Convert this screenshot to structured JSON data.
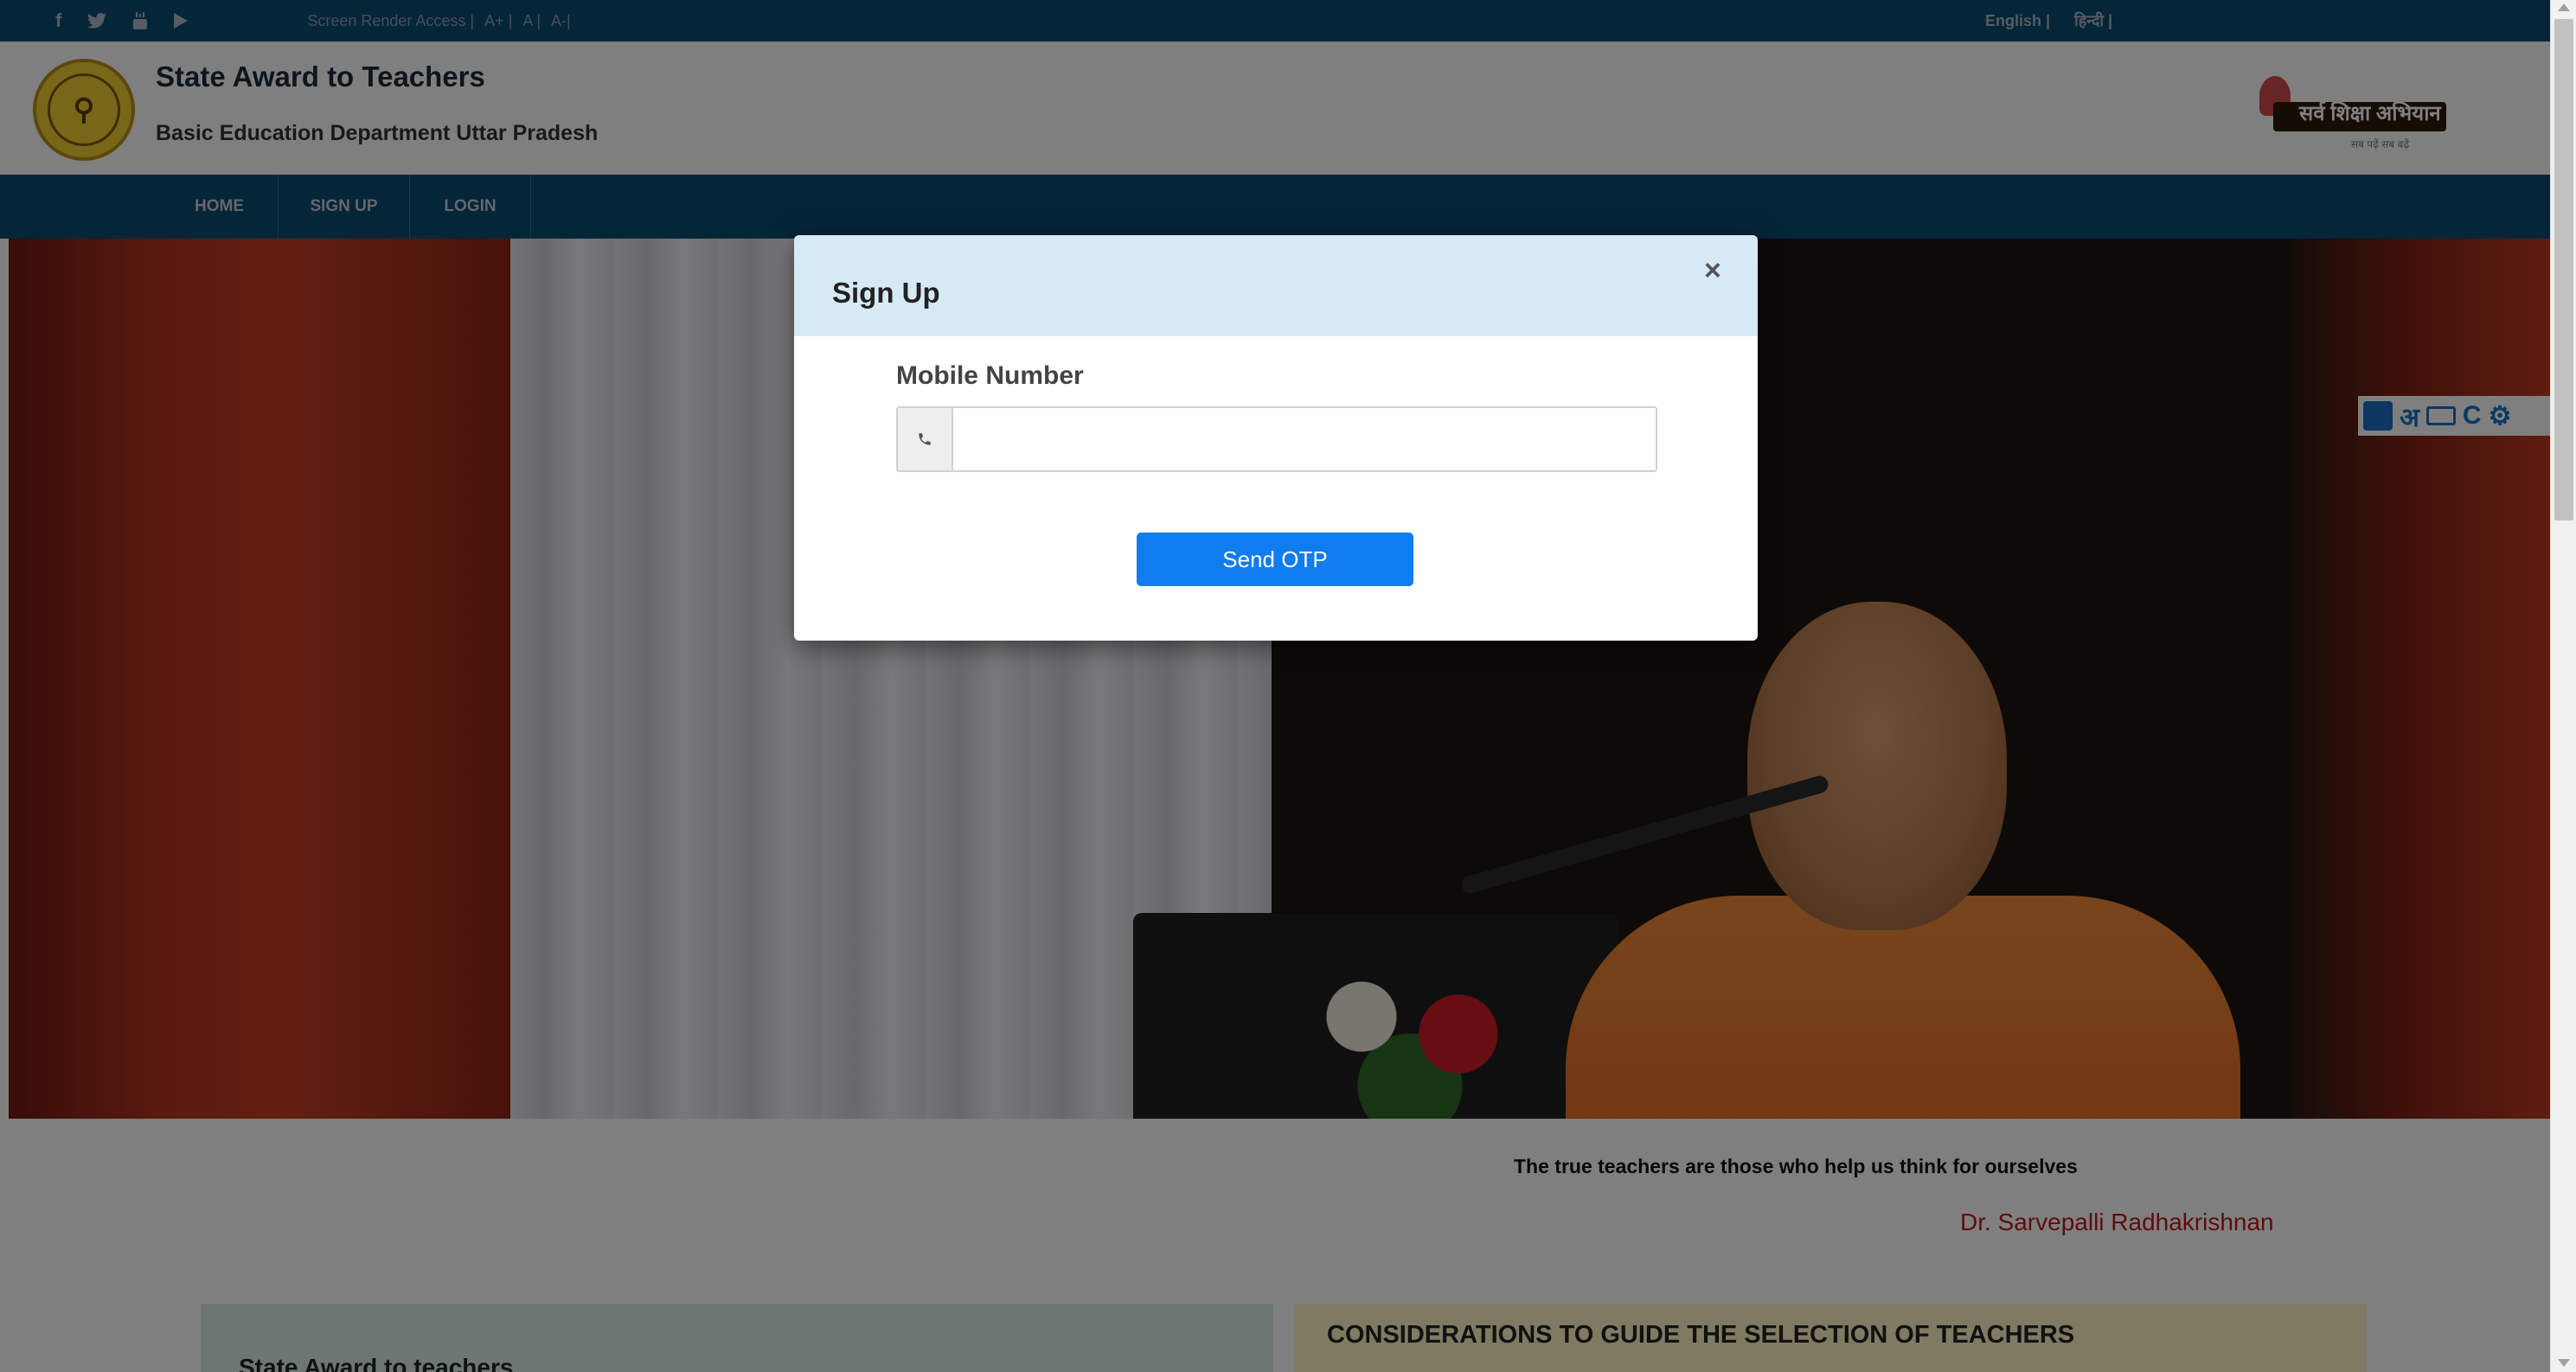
{
  "topbar": {
    "social": [
      {
        "icon": "facebook-icon",
        "glyph": "f"
      },
      {
        "icon": "twitter-icon",
        "glyph": "t"
      },
      {
        "icon": "youtube-icon",
        "glyph": "yt"
      },
      {
        "icon": "play-icon",
        "glyph": "play"
      }
    ],
    "accessibility": {
      "screen_reader": "Screen Render Access |",
      "font_increase": "A+ |",
      "font_normal": "A |",
      "font_decrease": "A-|"
    },
    "languages": {
      "english": "English |",
      "hindi": "हिन्दी |"
    }
  },
  "header": {
    "title": "State Award to Teachers",
    "subtitle": "Basic Education Department Uttar Pradesh",
    "right_logo_text": "सर्व शिक्षा अभियान",
    "right_logo_tagline": "सब पढ़ें सब बढ़ें"
  },
  "nav": {
    "home": "HOME",
    "signup": "SIGN UP",
    "login": "LOGIN"
  },
  "quote": {
    "text": "The true teachers are those who help us think for ourselves",
    "author": "Dr. Sarvepalli Radhakrishnan"
  },
  "panels": {
    "left_title": "State Award to teachers",
    "right_title": "CONSIDERATIONS TO GUIDE THE SELECTION OF TEACHERS"
  },
  "ime_toolbar": {
    "hindi_char": "अ",
    "c_label": "C"
  },
  "modal": {
    "title": "Sign Up",
    "close": "×",
    "mobile_label": "Mobile Number",
    "mobile_value": "",
    "phone_icon": "phone-icon",
    "send_button": "Send OTP"
  },
  "colors": {
    "topbar": "#0a4a72",
    "nav": "#0a4a72",
    "modal_header": "#d6eaf5",
    "send_button": "#0d7df0",
    "quote_author": "#c01818"
  }
}
